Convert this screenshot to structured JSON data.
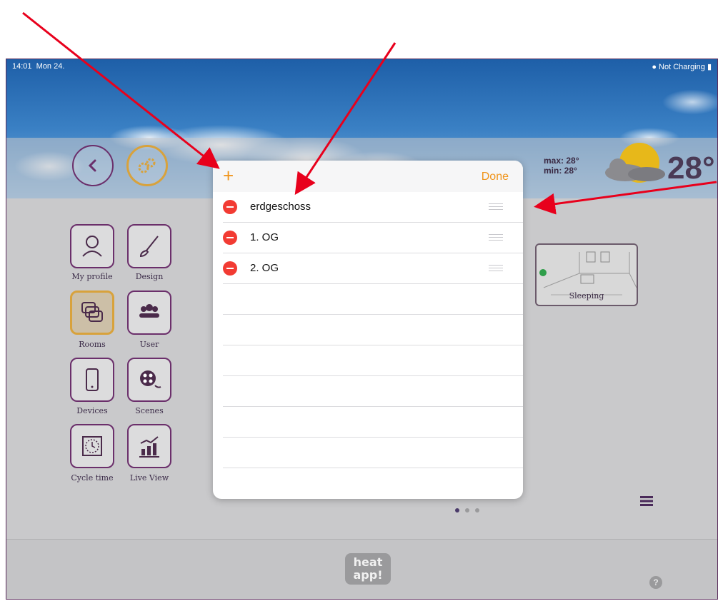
{
  "status_bar": {
    "time": "14:01",
    "date": "Mon 24.",
    "battery": "Not Charging"
  },
  "weather": {
    "max": "max: 28°",
    "min": "min: 28°",
    "temperature": "28°"
  },
  "menu": [
    {
      "label": "My profile"
    },
    {
      "label": "Design"
    },
    {
      "label": "Rooms"
    },
    {
      "label": "User"
    },
    {
      "label": "Devices"
    },
    {
      "label": "Scenes"
    },
    {
      "label": "Cycle time"
    },
    {
      "label": "Live View"
    }
  ],
  "room_card": {
    "name": "Sleeping"
  },
  "modal": {
    "add_label": "+",
    "done_label": "Done",
    "rows": [
      {
        "label": "erdgeschoss"
      },
      {
        "label": "1. OG"
      },
      {
        "label": "2. OG"
      }
    ]
  },
  "logo": {
    "line1": "heat",
    "line2": "app!"
  },
  "help": {
    "label": "?"
  },
  "colors": {
    "accent": "#f0951c",
    "delete": "#f23b33",
    "purple": "#6b2f6b",
    "gold": "#d8a23c",
    "arrow": "#e8001c"
  }
}
